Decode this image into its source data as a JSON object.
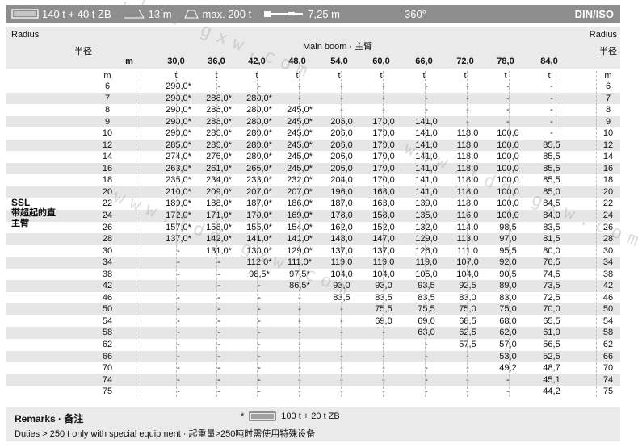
{
  "header": {
    "boom_config": "140 t + 40 t ZB",
    "radius_label": "13 m",
    "max_label": "max. 200 t",
    "counterweight_radius": "7,25 m",
    "slew": "360°",
    "standard": "DIN/ISO"
  },
  "table": {
    "radius_label": "Radius",
    "radius_label_cn": "半径",
    "main_boom_label": "Main boom · 主臂",
    "m_label": "m",
    "unit_m": "m",
    "unit_t": "t",
    "columns": [
      "30,0",
      "36,0",
      "42,0",
      "48,0",
      "54,0",
      "60,0",
      "66,0",
      "72,0",
      "78,0",
      "84,0"
    ],
    "side_label_1": "SSL",
    "side_label_2": "带超起的直",
    "side_label_3": "主臂",
    "rows": [
      {
        "r": "6",
        "v": [
          "290,0*",
          "-",
          "-",
          "-",
          "-",
          "-",
          "-",
          "-",
          "-",
          "-"
        ]
      },
      {
        "r": "7",
        "v": [
          "290,0*",
          "286,0*",
          "280,0*",
          "-",
          "-",
          "-",
          "-",
          "-",
          "-",
          "-"
        ]
      },
      {
        "r": "8",
        "v": [
          "290,0*",
          "286,0*",
          "280,0*",
          "245,0*",
          "-",
          "-",
          "-",
          "-",
          "-",
          "-"
        ]
      },
      {
        "r": "9",
        "v": [
          "290,0*",
          "286,0*",
          "280,0*",
          "245,0*",
          "206,0",
          "170,0",
          "141,0",
          "-",
          "-",
          "-"
        ]
      },
      {
        "r": "10",
        "v": [
          "290,0*",
          "286,0*",
          "280,0*",
          "245,0*",
          "206,0",
          "170,0",
          "141,0",
          "118,0",
          "100,0",
          "-"
        ]
      },
      {
        "r": "12",
        "v": [
          "285,0*",
          "286,0*",
          "280,0*",
          "245,0*",
          "206,0",
          "170,0",
          "141,0",
          "118,0",
          "100,0",
          "85,5"
        ]
      },
      {
        "r": "14",
        "v": [
          "274,0*",
          "276,0*",
          "280,0*",
          "245,0*",
          "206,0",
          "170,0",
          "141,0",
          "118,0",
          "100,0",
          "85,5"
        ]
      },
      {
        "r": "16",
        "v": [
          "263,0*",
          "261,0*",
          "265,0*",
          "245,0*",
          "206,0",
          "170,0",
          "141,0",
          "118,0",
          "100,0",
          "85,5"
        ]
      },
      {
        "r": "18",
        "v": [
          "235,0*",
          "234,0*",
          "233,0*",
          "232,0*",
          "204,0",
          "170,0",
          "141,0",
          "118,0",
          "100,0",
          "85,5"
        ]
      },
      {
        "r": "20",
        "v": [
          "210,0*",
          "209,0*",
          "207,0*",
          "207,0*",
          "196,0",
          "168,0",
          "141,0",
          "118,0",
          "100,0",
          "85,0"
        ]
      },
      {
        "r": "22",
        "v": [
          "189,0*",
          "188,0*",
          "187,0*",
          "186,0*",
          "187,0",
          "163,0",
          "139,0",
          "118,0",
          "100,0",
          "84,5"
        ]
      },
      {
        "r": "24",
        "v": [
          "172,0*",
          "171,0*",
          "170,0*",
          "169,0*",
          "178,0",
          "158,0",
          "135,0",
          "116,0",
          "100,0",
          "84,0"
        ]
      },
      {
        "r": "26",
        "v": [
          "157,0*",
          "156,0*",
          "155,0*",
          "154,0*",
          "162,0",
          "152,0",
          "132,0",
          "114,0",
          "98,5",
          "83,5"
        ]
      },
      {
        "r": "28",
        "v": [
          "137,0*",
          "142,0*",
          "141,0*",
          "141,0*",
          "148,0",
          "147,0",
          "129,0",
          "113,0",
          "97,0",
          "81,5"
        ]
      },
      {
        "r": "30",
        "v": [
          "-",
          "131,0*",
          "130,0*",
          "129,0*",
          "137,0",
          "137,0",
          "126,0",
          "111,0",
          "95,5",
          "80,0"
        ]
      },
      {
        "r": "34",
        "v": [
          "-",
          "-",
          "112,0*",
          "111,0*",
          "119,0",
          "119,0",
          "119,0",
          "107,0",
          "92,0",
          "76,5"
        ]
      },
      {
        "r": "38",
        "v": [
          "-",
          "-",
          "98,5*",
          "97,5*",
          "104,0",
          "104,0",
          "105,0",
          "104,0",
          "90,5",
          "74,5"
        ]
      },
      {
        "r": "42",
        "v": [
          "-",
          "-",
          "-",
          "86,5*",
          "93,0",
          "93,0",
          "93,5",
          "92,5",
          "89,0",
          "73,5"
        ]
      },
      {
        "r": "46",
        "v": [
          "-",
          "-",
          "-",
          "-",
          "83,5",
          "83,5",
          "83,5",
          "83,0",
          "83,0",
          "72,5"
        ]
      },
      {
        "r": "50",
        "v": [
          "-",
          "-",
          "-",
          "-",
          "-",
          "75,5",
          "75,5",
          "75,0",
          "75,0",
          "70,0"
        ]
      },
      {
        "r": "54",
        "v": [
          "-",
          "-",
          "-",
          "-",
          "-",
          "69,0",
          "69,0",
          "68,5",
          "68,0",
          "65,5"
        ]
      },
      {
        "r": "58",
        "v": [
          "-",
          "-",
          "-",
          "-",
          "-",
          "-",
          "63,0",
          "62,5",
          "62,0",
          "61,0"
        ]
      },
      {
        "r": "62",
        "v": [
          "-",
          "-",
          "-",
          "-",
          "-",
          "-",
          "-",
          "57,5",
          "57,0",
          "56,5"
        ]
      },
      {
        "r": "66",
        "v": [
          "-",
          "-",
          "-",
          "-",
          "-",
          "-",
          "-",
          "-",
          "53,0",
          "52,5"
        ]
      },
      {
        "r": "70",
        "v": [
          "-",
          "-",
          "-",
          "-",
          "-",
          "-",
          "-",
          "-",
          "49,2",
          "48,7"
        ]
      },
      {
        "r": "74",
        "v": [
          "-",
          "-",
          "-",
          "-",
          "-",
          "-",
          "-",
          "-",
          "-",
          "45,1"
        ]
      },
      {
        "r": "75",
        "v": [
          "-",
          "-",
          "-",
          "-",
          "-",
          "-",
          "-",
          "-",
          "-",
          "44,2"
        ]
      }
    ]
  },
  "remarks": {
    "title": "Remarks · 备注",
    "note": "Duties > 250 t only with special equipment · 起重量>250吨时需使用特殊设备",
    "legend_star": "*",
    "legend_text": "100 t + 20 t ZB"
  },
  "watermark": "www.ldd gxw.com"
}
